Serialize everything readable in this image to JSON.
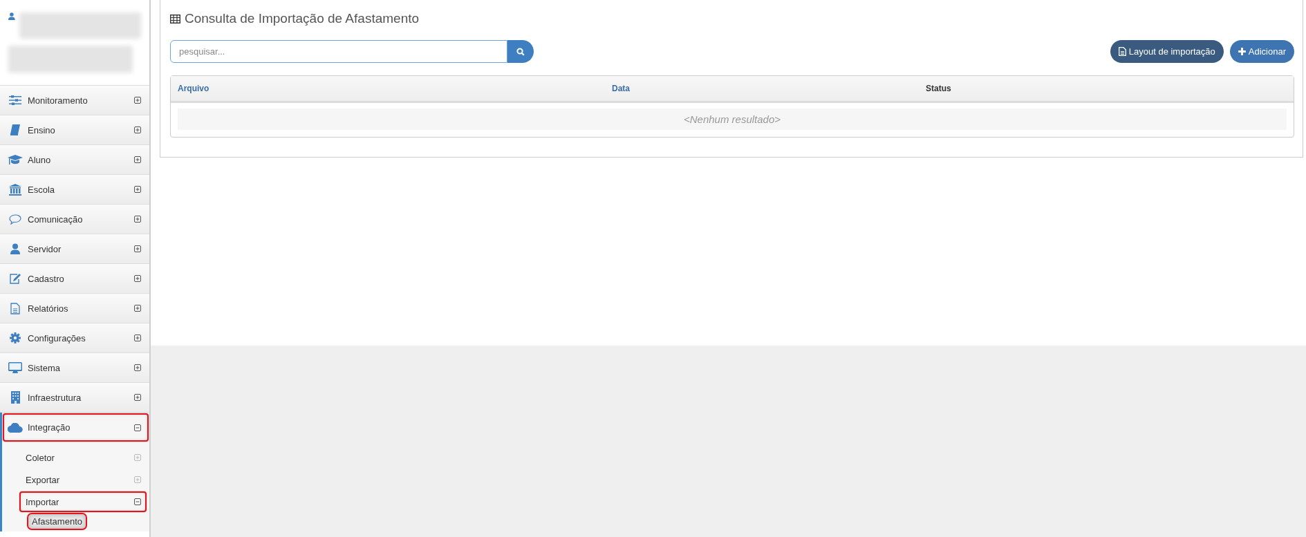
{
  "sidebar": {
    "items": [
      {
        "label": "Monitoramento",
        "expanded": false,
        "highlighted": false,
        "selected": false
      },
      {
        "label": "Ensino",
        "expanded": false,
        "highlighted": false,
        "selected": false
      },
      {
        "label": "Aluno",
        "expanded": false,
        "highlighted": false,
        "selected": false
      },
      {
        "label": "Escola",
        "expanded": false,
        "highlighted": false,
        "selected": false
      },
      {
        "label": "Comunicação",
        "expanded": false,
        "highlighted": false,
        "selected": false
      },
      {
        "label": "Servidor",
        "expanded": false,
        "highlighted": false,
        "selected": false
      },
      {
        "label": "Cadastro",
        "expanded": false,
        "highlighted": false,
        "selected": false
      },
      {
        "label": "Relatórios",
        "expanded": false,
        "highlighted": false,
        "selected": false
      },
      {
        "label": "Configurações",
        "expanded": false,
        "highlighted": false,
        "selected": false
      },
      {
        "label": "Sistema",
        "expanded": false,
        "highlighted": false,
        "selected": false
      },
      {
        "label": "Infraestrutura",
        "expanded": false,
        "highlighted": false,
        "selected": false
      },
      {
        "label": "Integração",
        "expanded": true,
        "highlighted": true,
        "selected": false,
        "children": [
          {
            "label": "Coletor",
            "expanded": false,
            "highlighted": false,
            "selected": false
          },
          {
            "label": "Exportar",
            "expanded": false,
            "highlighted": false,
            "selected": false
          },
          {
            "label": "Importar",
            "expanded": true,
            "highlighted": true,
            "selected": false,
            "children": [
              {
                "label": "Afastamento",
                "highlighted": true,
                "selected": true
              }
            ]
          }
        ]
      }
    ]
  },
  "page": {
    "title": "Consulta de Importação de Afastamento",
    "search": {
      "placeholder": "pesquisar..."
    },
    "buttons": [
      {
        "label": "Layout de importação",
        "kind": "layout"
      },
      {
        "label": "Adicionar",
        "kind": "add"
      }
    ],
    "table": {
      "columns": [
        {
          "label": "Arquivo",
          "sortable": true
        },
        {
          "label": "Data",
          "sortable": true
        },
        {
          "label": "Status",
          "sortable": false
        }
      ],
      "empty_message": "<Nenhum resultado>"
    }
  }
}
